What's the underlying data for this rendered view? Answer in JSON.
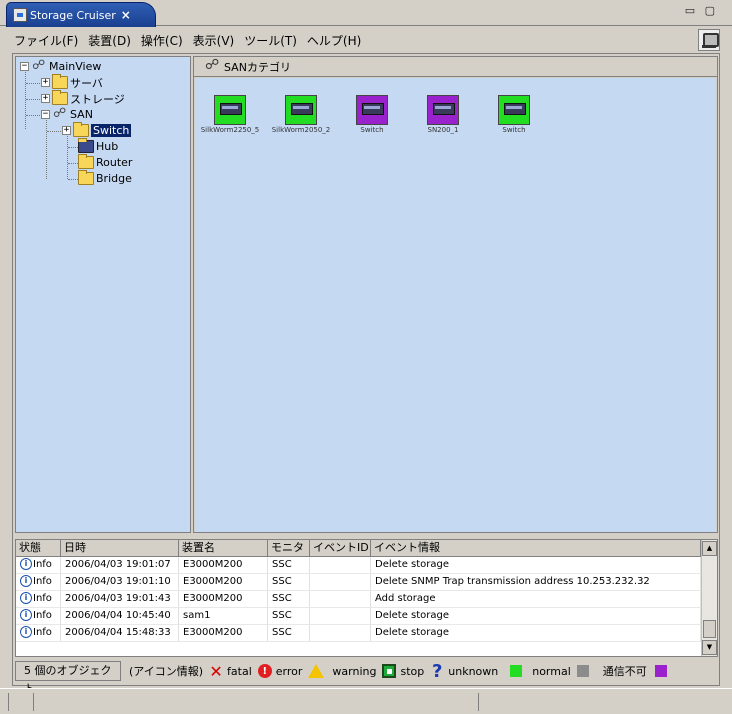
{
  "tab": {
    "title": "Storage Cruiser",
    "close": "×"
  },
  "window": {
    "controls": "▭ ▢"
  },
  "menu": [
    "ファイル(F)",
    "装置(D)",
    "操作(C)",
    "表示(V)",
    "ツール(T)",
    "ヘルプ(H)"
  ],
  "tree": {
    "root": "MainView",
    "server": "サーバ",
    "storage": "ストレージ",
    "san": "SAN",
    "switch": "Switch",
    "hub": "Hub",
    "router": "Router",
    "bridge": "Bridge"
  },
  "main": {
    "header": "SANカテゴリ",
    "devices": [
      {
        "label": "SilkWorm2250_5",
        "status": "normal"
      },
      {
        "label": "SilkWorm2050_2",
        "status": "normal"
      },
      {
        "label": "Switch",
        "status": "no-comm"
      },
      {
        "label": "SN200_1",
        "status": "no-comm"
      },
      {
        "label": "Switch",
        "status": "normal"
      }
    ]
  },
  "events": {
    "headers": [
      "状態",
      "日時",
      "装置名",
      "モニタ",
      "イベントID",
      "イベント情報"
    ],
    "rows": [
      [
        "Info",
        "2006/04/03 19:01:07",
        "E3000M200",
        "SSC",
        "",
        "Delete storage"
      ],
      [
        "Info",
        "2006/04/03 19:01:10",
        "E3000M200",
        "SSC",
        "",
        "Delete SNMP Trap transmission address 10.253.232.32"
      ],
      [
        "Info",
        "2006/04/03 19:01:43",
        "E3000M200",
        "SSC",
        "",
        "Add storage"
      ],
      [
        "Info",
        "2006/04/04 10:45:40",
        "sam1",
        "SSC",
        "",
        "Delete storage"
      ],
      [
        "Info",
        "2006/04/04 15:48:33",
        "E3000M200",
        "SSC",
        "",
        "Delete storage"
      ]
    ]
  },
  "legend": {
    "count": "5 個のオブジェクト",
    "title": "(アイコン情報)",
    "fatal": "fatal",
    "error": "error",
    "warning": "warning",
    "stop": "stop",
    "unknown": "unknown",
    "normal": "normal",
    "nocomm": "通信不可"
  },
  "colors": {
    "normal": "#22dd22",
    "nocomm": "#9922cc",
    "gray": "#8c8c8c",
    "panel_bg": "#c6d9f3"
  }
}
